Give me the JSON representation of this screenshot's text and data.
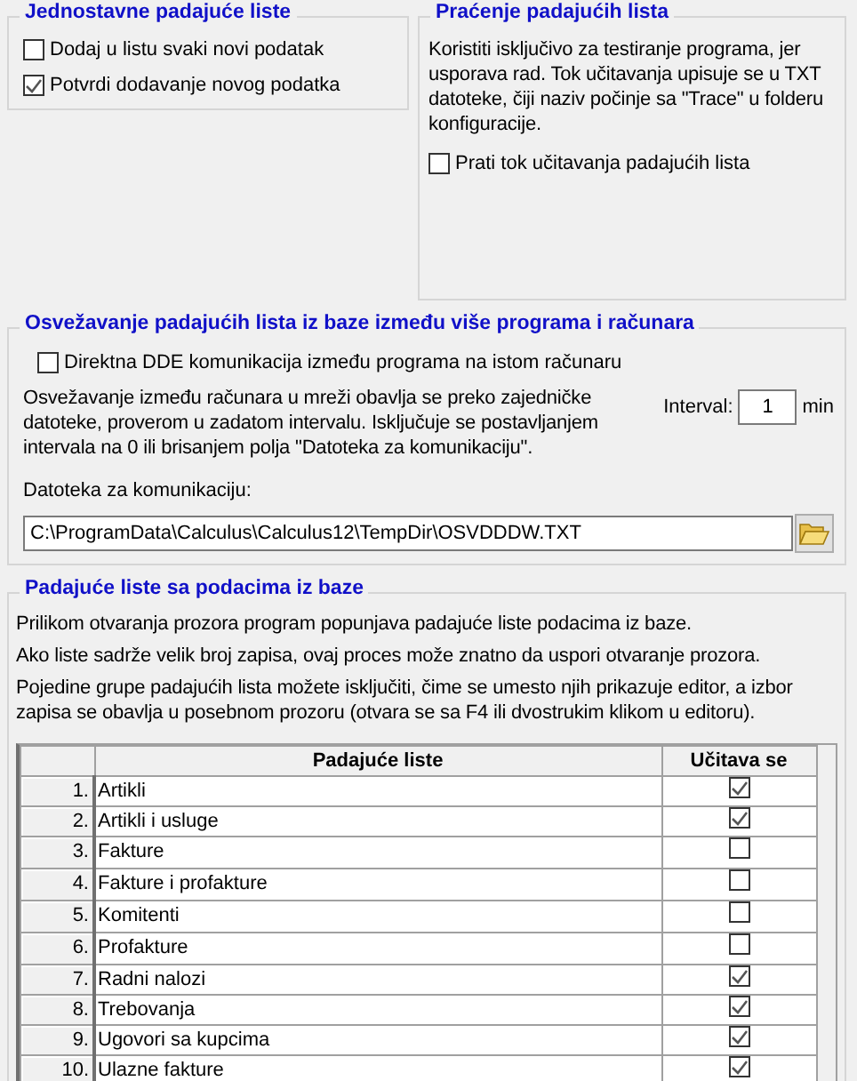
{
  "simple": {
    "title": "Jednostavne padajuće liste",
    "options": [
      {
        "label": "Dodaj u listu svaki novi podatak",
        "checked": false
      },
      {
        "label": "Potvrdi dodavanje novog podatka",
        "checked": true
      }
    ]
  },
  "tracing": {
    "title": "Praćenje padajućih lista",
    "description": "Koristiti isključivo za testiranje programa, jer usporava rad. Tok učitavanja upisuje se u TXT datoteke, čiji naziv počinje sa \"Trace\"  u folderu konfiguracije.",
    "option": {
      "label": "Prati tok učitavanja padajućih lista",
      "checked": false
    }
  },
  "refresh": {
    "title": "Osvežavanje padajućih lista iz baze između više programa i računara",
    "dde": {
      "label": "Direktna DDE komunikacija između programa na istom računaru",
      "checked": false
    },
    "description": "Osvežavanje između računara u mreži obavlja se preko zajedničke datoteke, proverom u zadatom intervalu. Isključuje se postavljanjem intervala na 0 ili brisanjem polja \"Datoteka za komunikaciju\".",
    "interval_label": "Interval:",
    "interval_value": "1",
    "interval_unit": "min",
    "file_label": "Datoteka za komunikaciju:",
    "file_value": "C:\\ProgramData\\Calculus\\Calculus12\\TempDir\\OSVDDDW.TXT"
  },
  "lists": {
    "title": "Padajuće liste sa podacima iz baze",
    "paragraphs": [
      "Prilikom otvaranja prozora program popunjava padajuće liste podacima iz baze.",
      "Ako liste sadrže velik broj zapisa, ovaj proces može znatno da uspori otvaranje prozora.",
      "Pojedine grupe padajućih lista možete isključiti, čime se umesto njih prikazuje editor, a izbor zapisa se obavlja u posebnom prozoru (otvara se sa F4 ili dvostrukim klikom u editoru)."
    ],
    "table": {
      "columns": [
        "Padajuće liste",
        "Učitava se"
      ],
      "rows": [
        {
          "number": "1.",
          "name": "Artikli",
          "checked": true
        },
        {
          "number": "2.",
          "name": "Artikli i usluge",
          "checked": true
        },
        {
          "number": "3.",
          "name": "Fakture",
          "checked": false
        },
        {
          "number": "4.",
          "name": "Fakture i profakture",
          "checked": false
        },
        {
          "number": "5.",
          "name": "Komitenti",
          "checked": false
        },
        {
          "number": "6.",
          "name": "Profakture",
          "checked": false
        },
        {
          "number": "7.",
          "name": "Radni nalozi",
          "checked": true
        },
        {
          "number": "8.",
          "name": "Trebovanja",
          "checked": true
        },
        {
          "number": "9.",
          "name": "Ugovori sa kupcima",
          "checked": true
        },
        {
          "number": "10.",
          "name": "Ulazne fakture",
          "checked": true
        }
      ]
    }
  }
}
